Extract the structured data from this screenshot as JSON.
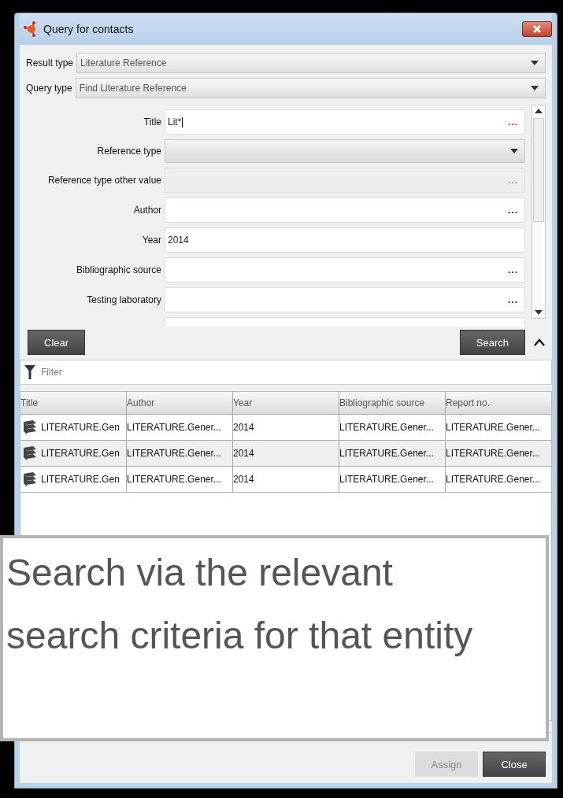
{
  "window": {
    "title": "Query for contacts"
  },
  "selectors": [
    {
      "label": "Result type",
      "value": "Literature Reference"
    },
    {
      "label": "Query type",
      "value": "Find Literature Reference"
    }
  ],
  "criteria": [
    {
      "label": "Title",
      "kind": "text",
      "value": "Lit*",
      "button": "...",
      "required": true
    },
    {
      "label": "Reference type",
      "kind": "dropdown"
    },
    {
      "label": "Reference type other value",
      "kind": "disabled",
      "button": "..."
    },
    {
      "label": "Author",
      "kind": "text",
      "button": "...",
      "required": false
    },
    {
      "label": "Year",
      "kind": "text",
      "value": "2014"
    },
    {
      "label": "Bibliographic source",
      "kind": "text",
      "button": "...",
      "required": false
    },
    {
      "label": "Testing laboratory",
      "kind": "text",
      "button": "...",
      "required": false
    }
  ],
  "actions": {
    "clear": "Clear",
    "search": "Search"
  },
  "filter": {
    "placeholder": "Filter"
  },
  "table": {
    "columns": [
      "Title",
      "Author",
      "Year",
      "Bibliographic source",
      "Report no."
    ],
    "rows": [
      [
        "LITERATURE.Gen",
        "LITERATURE.Gener...",
        "2014",
        "LITERATURE.Gener...",
        "LITERATURE.Gener..."
      ],
      [
        "LITERATURE.Gen",
        "LITERATURE.Gener...",
        "2014",
        "LITERATURE.Gener...",
        "LITERATURE.Gener..."
      ],
      [
        "LITERATURE.Gen",
        "LITERATURE.Gener...",
        "2014",
        "LITERATURE.Gener...",
        "LITERATURE.Gener..."
      ]
    ]
  },
  "callout": "Search via the relevant search criteria for that entity",
  "buttons": [
    {
      "label": "Assign",
      "disabled": true
    },
    {
      "label": "Close",
      "disabled": false
    }
  ]
}
